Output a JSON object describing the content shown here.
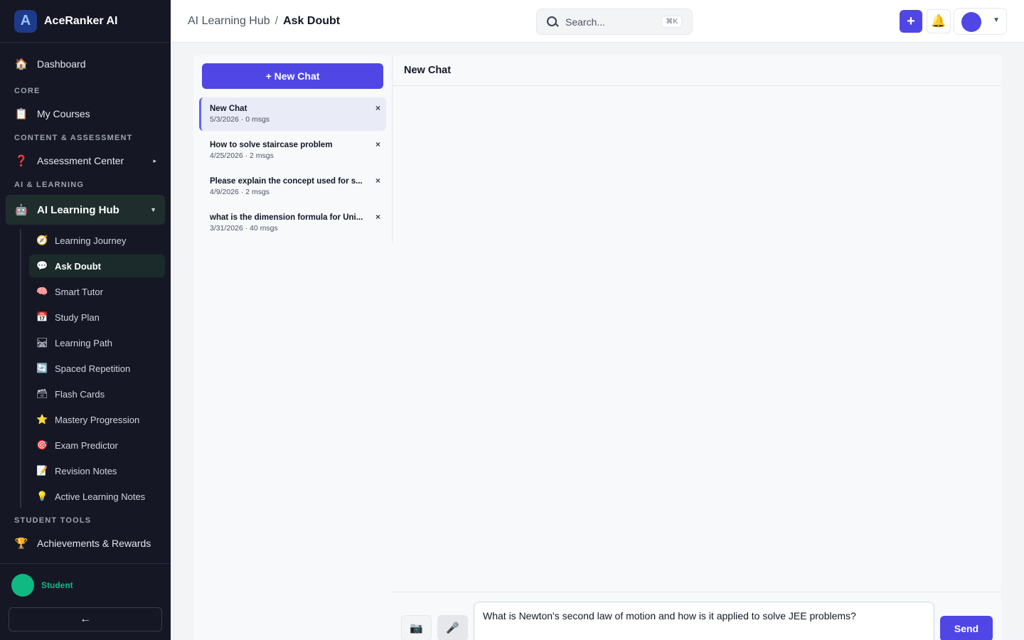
{
  "brand": {
    "name": "AceRanker AI",
    "logo_char": "A"
  },
  "sidebar": {
    "dashboard": {
      "label": "Dashboard",
      "icon": "house-icon"
    },
    "sections": {
      "core": "CORE",
      "content": "CONTENT & ASSESSMENT",
      "ai": "AI & LEARNING",
      "tools": "STUDENT TOOLS"
    },
    "my_courses": {
      "label": "My Courses",
      "icon": "clipboard-icon"
    },
    "assessment": {
      "label": "Assessment Center",
      "icon": "question-icon"
    },
    "ai_hub": {
      "label": "AI Learning Hub",
      "icon": "robot-icon"
    },
    "sub_items": [
      {
        "label": "Learning Journey",
        "icon": "compass-icon",
        "glyph": "🧭"
      },
      {
        "label": "Ask Doubt",
        "icon": "speech-bubble-icon",
        "glyph": "💬"
      },
      {
        "label": "Smart Tutor",
        "icon": "brain-icon",
        "glyph": "🧠"
      },
      {
        "label": "Study Plan",
        "icon": "calendar-icon",
        "glyph": "📅"
      },
      {
        "label": "Learning Path",
        "icon": "railway-track-icon",
        "glyph": "🛤"
      },
      {
        "label": "Spaced Repetition",
        "icon": "refresh-icon",
        "glyph": "🔄"
      },
      {
        "label": "Flash Cards",
        "icon": "card-file-box-icon",
        "glyph": "🗃"
      },
      {
        "label": "Mastery Progression",
        "icon": "star-icon",
        "glyph": "⭐"
      },
      {
        "label": "Exam Predictor",
        "icon": "target-icon",
        "glyph": "🎯"
      },
      {
        "label": "Revision Notes",
        "icon": "memo-icon",
        "glyph": "📝"
      },
      {
        "label": "Active Learning Notes",
        "icon": "lightbulb-icon",
        "glyph": "💡"
      }
    ],
    "achievements": {
      "label": "Achievements & Rewards",
      "icon": "trophy-icon"
    },
    "user": {
      "role": "Student"
    },
    "collapse_glyph": "←"
  },
  "header": {
    "breadcrumb_parent": "AI Learning Hub",
    "breadcrumb_sep": "/",
    "breadcrumb_current": "Ask Doubt",
    "search_placeholder": "Search...",
    "search_shortcut": "⌘K",
    "plus_glyph": "+",
    "bell_glyph": "🔔",
    "caret_glyph": "▼"
  },
  "chat_list": {
    "new_chat_label": "+ New Chat",
    "items": [
      {
        "title": "New Chat",
        "meta": "5/3/2026 · 0 msgs"
      },
      {
        "title": "How to solve staircase problem",
        "meta": "4/25/2026 · 2 msgs"
      },
      {
        "title": "Please explain the concept used for s...",
        "meta": "4/9/2026 · 2 msgs"
      },
      {
        "title": "what is the dimension formula for Uni...",
        "meta": "3/31/2026 · 40 msgs"
      }
    ],
    "close_glyph": "×"
  },
  "chat": {
    "title": "New Chat",
    "input_value": "What is Newton's second law of motion and how is it applied to solve JEE problems?",
    "send_label": "Send",
    "camera_glyph": "📷",
    "mic_glyph": "🎤"
  },
  "colors": {
    "accent": "#4f46e5",
    "success": "#10b981",
    "sidebar_bg": "#161725"
  }
}
